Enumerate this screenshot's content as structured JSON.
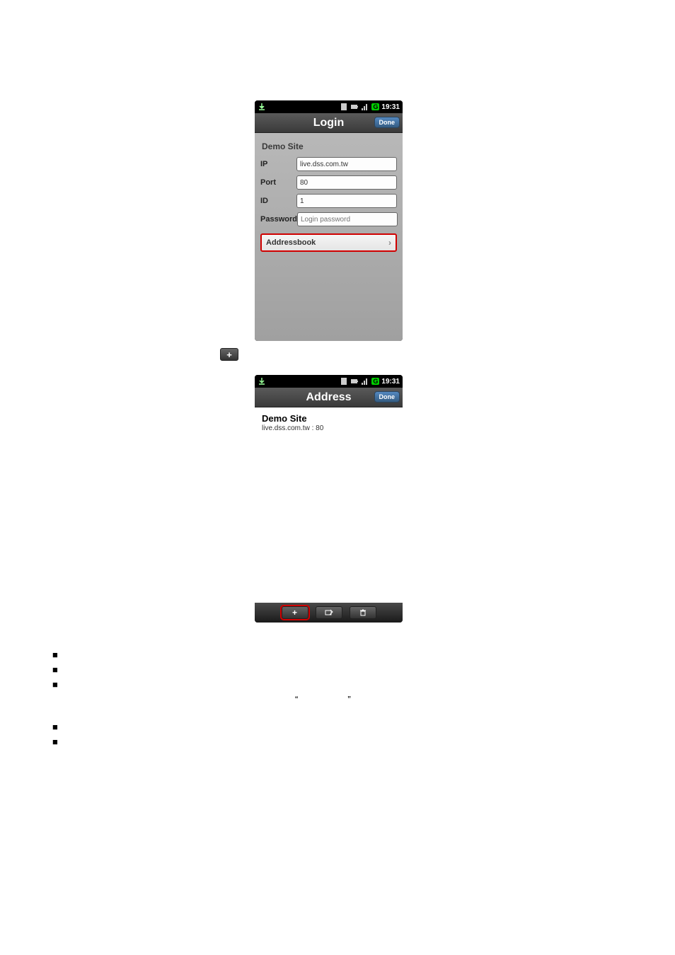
{
  "status": {
    "time": "19:31",
    "g_badge": "G"
  },
  "login_screen": {
    "title": "Login",
    "done": "Done",
    "section": "Demo Site",
    "rows": {
      "ip_label": "IP",
      "ip_value": "live.dss.com.tw",
      "port_label": "Port",
      "port_value": "80",
      "id_label": "ID",
      "id_value": "1",
      "password_label": "Password",
      "password_placeholder": "Login password"
    },
    "addressbook_label": "Addressbook"
  },
  "address_screen": {
    "title": "Address",
    "done": "Done",
    "item_name": "Demo Site",
    "item_sub": "live.dss.com.tw : 80"
  },
  "icons": {
    "plus": "+"
  },
  "bullets": [
    "■",
    "■",
    "■",
    "■",
    "■"
  ],
  "quotes": {
    "open": "“",
    "close": "”"
  }
}
